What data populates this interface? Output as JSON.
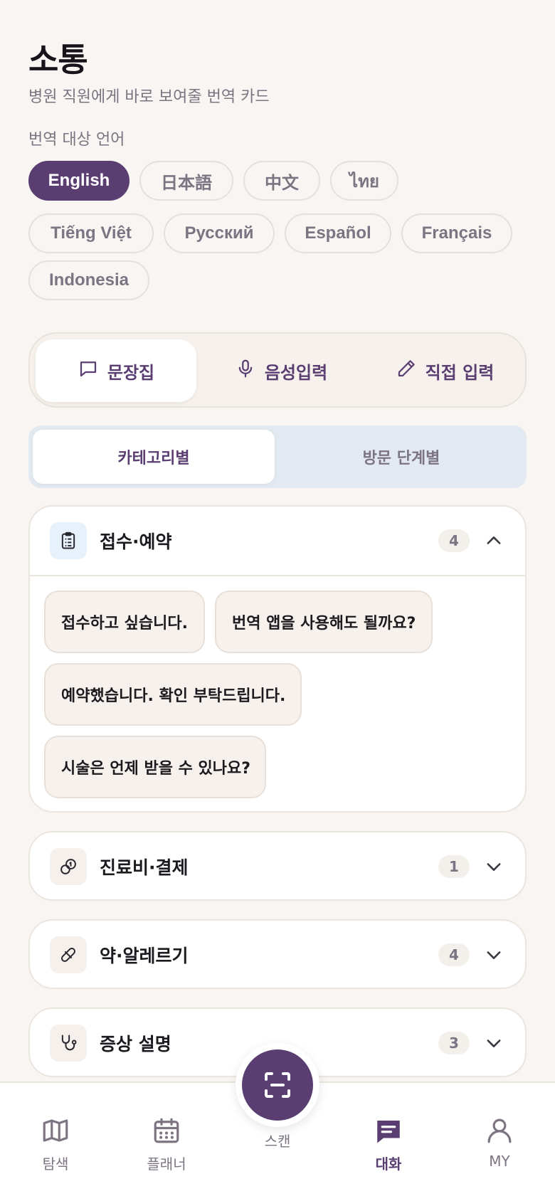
{
  "header": {
    "title": "소통",
    "subtitle": "병원 직원에게 바로 보여줄 번역 카드",
    "language_heading": "번역 대상 언어"
  },
  "languages": [
    {
      "label": "English",
      "selected": true
    },
    {
      "label": "日本語",
      "selected": false
    },
    {
      "label": "中文",
      "selected": false
    },
    {
      "label": "ไทย",
      "selected": false
    },
    {
      "label": "Tiếng Việt",
      "selected": false
    },
    {
      "label": "Русский",
      "selected": false
    },
    {
      "label": "Español",
      "selected": false
    },
    {
      "label": "Français",
      "selected": false
    },
    {
      "label": "Indonesia",
      "selected": false
    }
  ],
  "modes": [
    {
      "label": "문장집",
      "icon": "chat-bubble-icon",
      "selected": true
    },
    {
      "label": "음성입력",
      "icon": "microphone-icon",
      "selected": false
    },
    {
      "label": "직접 입력",
      "icon": "pencil-icon",
      "selected": false
    }
  ],
  "view_toggle": [
    {
      "label": "카테고리별",
      "selected": true
    },
    {
      "label": "방문 단계별",
      "selected": false
    }
  ],
  "categories": [
    {
      "title": "접수·예약",
      "count": "4",
      "icon": "clipboard-icon",
      "expanded": true,
      "phrases": [
        "접수하고 싶습니다.",
        "번역 앱을 사용해도 될까요?",
        "예약했습니다. 확인 부탁드립니다.",
        "시술은 언제 받을 수 있나요?"
      ]
    },
    {
      "title": "진료비·결제",
      "count": "1",
      "icon": "coins-icon",
      "expanded": false
    },
    {
      "title": "약·알레르기",
      "count": "4",
      "icon": "pill-icon",
      "expanded": false
    },
    {
      "title": "증상 설명",
      "count": "3",
      "icon": "stethoscope-icon",
      "expanded": false
    }
  ],
  "nav": {
    "items": [
      {
        "label": "탐색",
        "icon": "map-icon",
        "active": false
      },
      {
        "label": "플래너",
        "icon": "calendar-icon",
        "active": false
      },
      {
        "label": "대화",
        "icon": "message-icon",
        "active": true
      },
      {
        "label": "MY",
        "icon": "user-icon",
        "active": false
      }
    ],
    "scan_label": "스캔",
    "scan_icon": "scan-icon"
  },
  "colors": {
    "accent": "#5a3e72",
    "background": "#f8f5f2",
    "segment_bg": "#e3e9f1"
  }
}
